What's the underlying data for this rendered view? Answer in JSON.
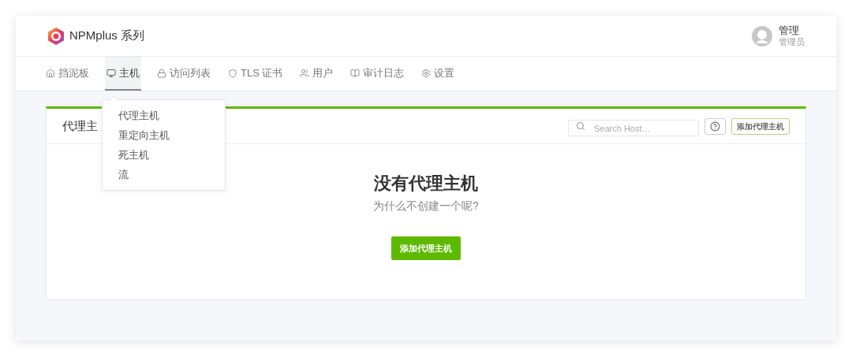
{
  "brand": {
    "name": "NPMplus 系列"
  },
  "user": {
    "name": "管理",
    "role": "管理员"
  },
  "nav": [
    {
      "label": "挡泥板",
      "selected": false
    },
    {
      "label": "主机",
      "selected": true
    },
    {
      "label": "访问列表",
      "selected": false
    },
    {
      "label": "TLS 证书",
      "selected": false
    },
    {
      "label": "用户",
      "selected": false
    },
    {
      "label": "审计日志",
      "selected": false
    },
    {
      "label": "设置",
      "selected": false
    }
  ],
  "dropdown": {
    "items": [
      "代理主机",
      "重定向主机",
      "死主机",
      "流"
    ]
  },
  "card": {
    "title": "代理主",
    "search": {
      "placeholder": "Search Host…"
    },
    "add_button": "添加代理主机",
    "empty": {
      "title": "没有代理主机",
      "subtitle": "为什么不创建一个呢?",
      "button": "添加代理主机"
    }
  }
}
